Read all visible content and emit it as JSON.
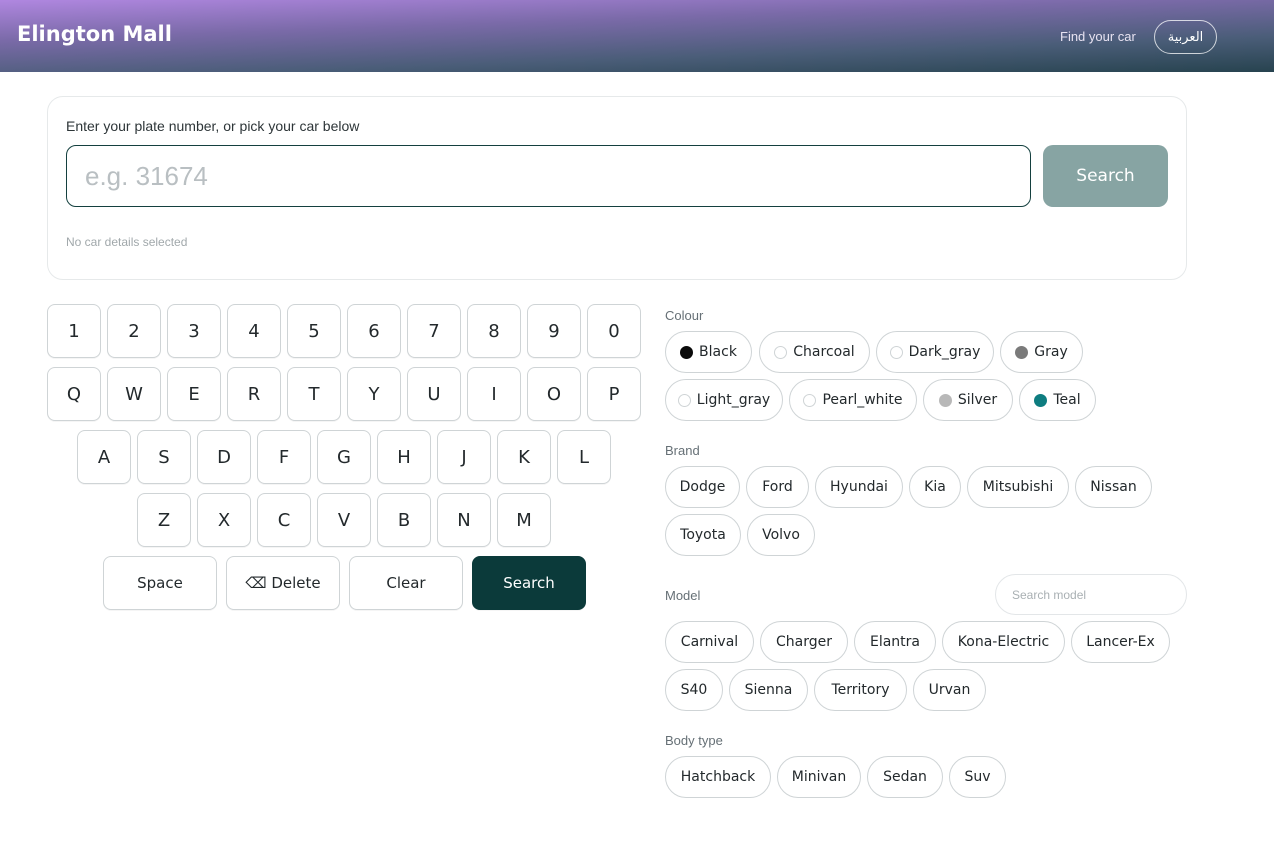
{
  "header": {
    "title": "Elington Mall",
    "find_link": "Find your car",
    "lang_button": "العربية"
  },
  "search": {
    "label": "Enter your plate number, or pick your car below",
    "placeholder": "e.g. 31674",
    "button": "Search",
    "status": "No car details selected"
  },
  "keyboard": {
    "row1": [
      "1",
      "2",
      "3",
      "4",
      "5",
      "6",
      "7",
      "8",
      "9",
      "0"
    ],
    "row2": [
      "Q",
      "W",
      "E",
      "R",
      "T",
      "Y",
      "U",
      "I",
      "O",
      "P"
    ],
    "row3": [
      "A",
      "S",
      "D",
      "F",
      "G",
      "H",
      "J",
      "K",
      "L"
    ],
    "row4": [
      "Z",
      "X",
      "C",
      "V",
      "B",
      "N",
      "M"
    ],
    "space": "Space",
    "delete": "⌫ Delete",
    "clear": "Clear",
    "search": "Search"
  },
  "colour": {
    "label": "Colour",
    "options": [
      {
        "name": "Black",
        "color": "#0b0b0b"
      },
      {
        "name": "Charcoal",
        "color": "#ffffff"
      },
      {
        "name": "Dark_gray",
        "color": "#ffffff"
      },
      {
        "name": "Gray",
        "color": "#7a7a7a"
      },
      {
        "name": "Light_gray",
        "color": "#ffffff"
      },
      {
        "name": "Pearl_white",
        "color": "#ffffff"
      },
      {
        "name": "Silver",
        "color": "#b8b8b8"
      },
      {
        "name": "Teal",
        "color": "#0e7d80"
      }
    ]
  },
  "brand": {
    "label": "Brand",
    "options": [
      "Dodge",
      "Ford",
      "Hyundai",
      "Kia",
      "Mitsubishi",
      "Nissan",
      "Toyota",
      "Volvo"
    ]
  },
  "model": {
    "label": "Model",
    "search_placeholder": "Search model",
    "options": [
      "Carnival",
      "Charger",
      "Elantra",
      "Kona-Electric",
      "Lancer-Ex",
      "S40",
      "Sienna",
      "Territory",
      "Urvan"
    ]
  },
  "body_type": {
    "label": "Body type",
    "options": [
      "Hatchback",
      "Minivan",
      "Sedan",
      "Suv"
    ]
  }
}
